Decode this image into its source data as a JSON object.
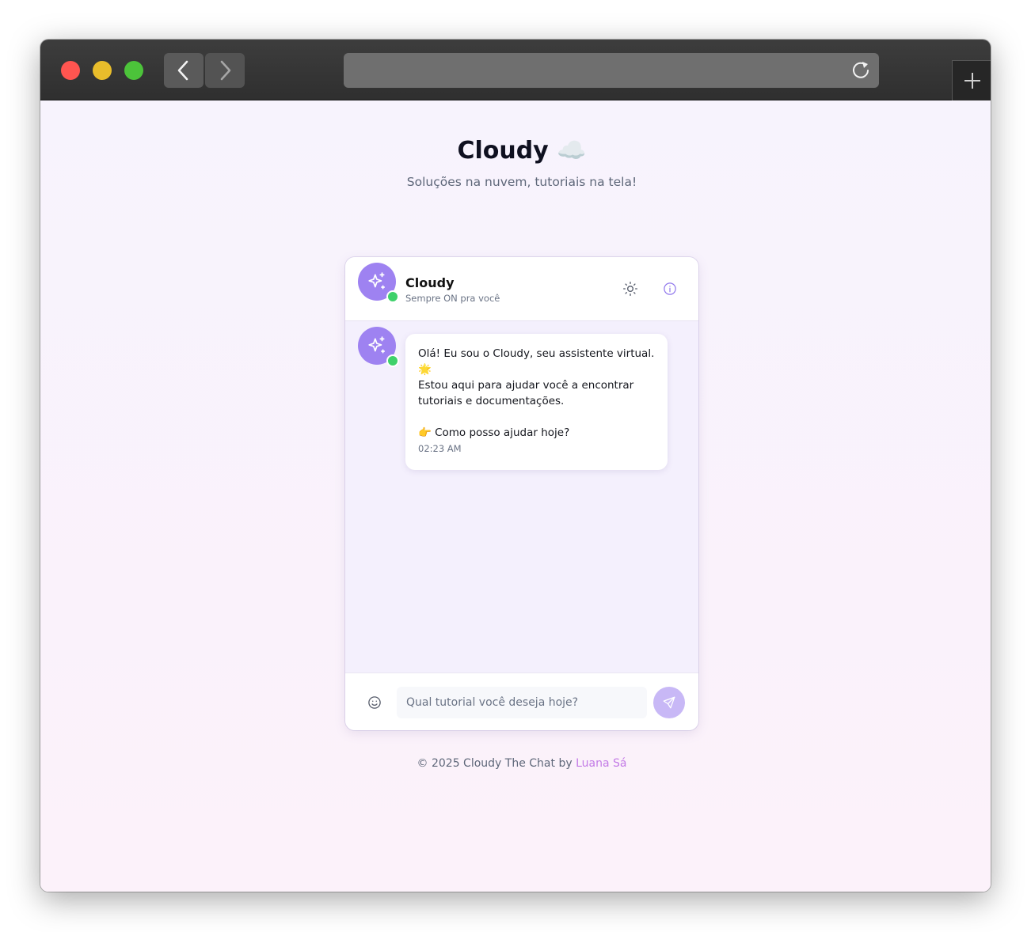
{
  "browser": {
    "url": "",
    "icons": {
      "back": "chevron-left-icon",
      "forward": "chevron-right-icon",
      "reload": "reload-icon",
      "new_tab": "plus-icon"
    }
  },
  "page": {
    "title": "Cloudy ☁️",
    "subtitle": "Soluções na nuvem, tutoriais na tela!"
  },
  "chat": {
    "header": {
      "name": "Cloudy",
      "status": "Sempre ON pra você",
      "online": true,
      "icons": [
        "sparkles-icon",
        "sun-icon",
        "info-icon"
      ]
    },
    "messages": [
      {
        "sender": "bot",
        "lines": [
          "Olá! Eu sou o Cloudy, seu assistente virtual.",
          "🌟",
          "Estou aqui para ajudar você a encontrar",
          "tutoriais e documentações.",
          "",
          "👉 Como posso ajudar hoje?"
        ],
        "time": "02:23 AM"
      }
    ],
    "input": {
      "value": "",
      "placeholder": "Qual tutorial você deseja hoje?"
    }
  },
  "footer": {
    "text": "© 2025 Cloudy The Chat by ",
    "author": "Luana Sá"
  },
  "colors": {
    "accent": "#9e82f1",
    "send_button": "#c8b8f6",
    "online": "#3fd16b",
    "author_link": "#c37be6"
  }
}
